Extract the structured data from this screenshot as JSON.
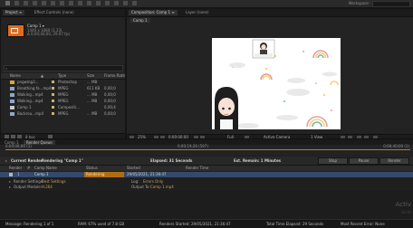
{
  "toolbar": {
    "tool_icons": [
      "home-icon",
      "arrow-icon",
      "hand-icon",
      "zoom-icon",
      "rotate-icon",
      "camera-icon",
      "pan-behind-icon",
      "rectangle-icon",
      "pen-icon",
      "text-icon",
      "brush-icon",
      "stamp-icon",
      "eraser-icon",
      "roto-icon",
      "puppet-icon"
    ],
    "workspace": "Workspace:"
  },
  "project_panel": {
    "tabs": [
      "Project ≡",
      "Effect Controls (none)"
    ],
    "comp_name": "Comp 1 ▾",
    "comp_info1": "1440 x 1080 (1.33)",
    "comp_info2": "Δ 0;00;40;00, 29.97 fps",
    "columns": [
      "Name",
      "▲",
      "Type",
      "Size",
      "Frame Rate"
    ],
    "rows": [
      {
        "name": "pngwing3...",
        "type": "Photoshop",
        "size": "... MB",
        "fr": "",
        "color": "#d9a53a"
      },
      {
        "name": "Breathing fa...mp4",
        "type": "MPEG",
        "size": "611 KB",
        "fr": "0,00;0",
        "color": "#8fa7c9"
      },
      {
        "name": "Walking...mp4",
        "type": "MPEG",
        "size": "... MB",
        "fr": "0,00;0",
        "color": "#8fa7c9"
      },
      {
        "name": "Walking...mp4",
        "type": "MPEG",
        "size": "... MB",
        "fr": "0,00;0",
        "color": "#8fa7c9"
      },
      {
        "name": "Comp 1",
        "type": "Compositi...",
        "size": "",
        "fr": "0,00;4",
        "color": "#c9c9c9"
      },
      {
        "name": "Backrou...mp4",
        "type": "MPEG",
        "size": "... MB",
        "fr": "0,00;0",
        "color": "#8fa7c9"
      }
    ],
    "bottom": "8 bpc"
  },
  "comp_panel": {
    "tabs": [
      "Composition: Comp 1 ≡",
      "Layer (none)"
    ],
    "crumb": "Comp 1",
    "viewer": {
      "zoom": "25%",
      "timecode": "0;00;00;00",
      "quality": "Full",
      "camera": "Active Camera",
      "views": "1 View"
    }
  },
  "timeline": {
    "tabs": [
      "Comp 1",
      "Render Queue"
    ],
    "time_left": "0;00;00;00 (1)",
    "time_mid": "0;00;19;26 (597)",
    "time_right": "0;00;40;00 (1)"
  },
  "render_queue": {
    "current_render_label": "Current Render",
    "rendering_label": "Rendering \"Comp 1\"",
    "elapsed_label": "Elapsed: 31 Seconds",
    "remain_label": "Est. Remain: 1 Minutes",
    "buttons": [
      "Stop",
      "Pause",
      "Render"
    ],
    "columns": [
      "Render",
      "#",
      "Comp Name",
      "Status",
      "Started",
      "Render Time"
    ],
    "item": {
      "num": "1",
      "comp": "Comp 1",
      "status": "Rendering",
      "started": "29/05/2021, 21:36:47"
    },
    "render_settings_label": "Render Settings:",
    "render_settings_value": "Best Settings",
    "output_module_label": "Output Module:",
    "output_module_value": "H.264",
    "log_label": "Log:",
    "log_value": "Errors Only",
    "output_to_label": "Output To:",
    "output_to_value": "Comp 1.mp4"
  },
  "statusbar": {
    "message": "Message: Rendering 1 of 1",
    "ram": "RAM: 67% used of 7.8 GB",
    "started": "Renders Started: 29/05/2021, 21:36:47",
    "total": "Total Time Elapsed: 29 Seconds",
    "recent": "Most Recent Error: None"
  },
  "watermark": {
    "line1": "Activ",
    "line2": "Go to"
  },
  "colors": {
    "accent": "#c77a12",
    "selection": "#3a4f73",
    "thumb": "#e06b20"
  }
}
